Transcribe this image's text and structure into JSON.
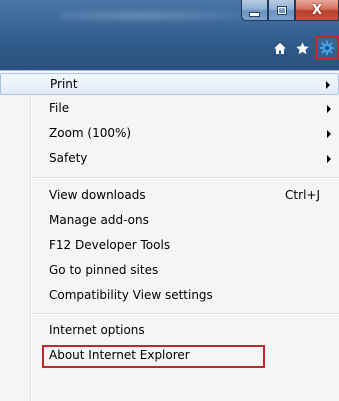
{
  "window": {
    "caption_buttons": {
      "minimize_icon": "minimize-icon",
      "maximize_icon": "maximize-icon",
      "close_glyph": "X"
    },
    "command_bar": {
      "home_icon": "home-icon",
      "favorites_icon": "star-icon",
      "tools_icon": "gear-icon"
    }
  },
  "menu": {
    "items": [
      {
        "label": "Print",
        "submenu": true
      },
      {
        "label": "File",
        "submenu": true
      },
      {
        "label": "Zoom (100%)",
        "submenu": true
      },
      {
        "label": "Safety",
        "submenu": true
      },
      {
        "label": "View downloads",
        "shortcut": "Ctrl+J"
      },
      {
        "label": "Manage add-ons"
      },
      {
        "label": "F12 Developer Tools"
      },
      {
        "label": "Go to pinned sites"
      },
      {
        "label": "Compatibility View settings"
      },
      {
        "label": "Internet options"
      },
      {
        "label": "About Internet Explorer"
      }
    ]
  },
  "colors": {
    "title_bar": "#2e5886",
    "highlight_border": "#c0282a",
    "hover_fill": "#e1ecf8"
  }
}
